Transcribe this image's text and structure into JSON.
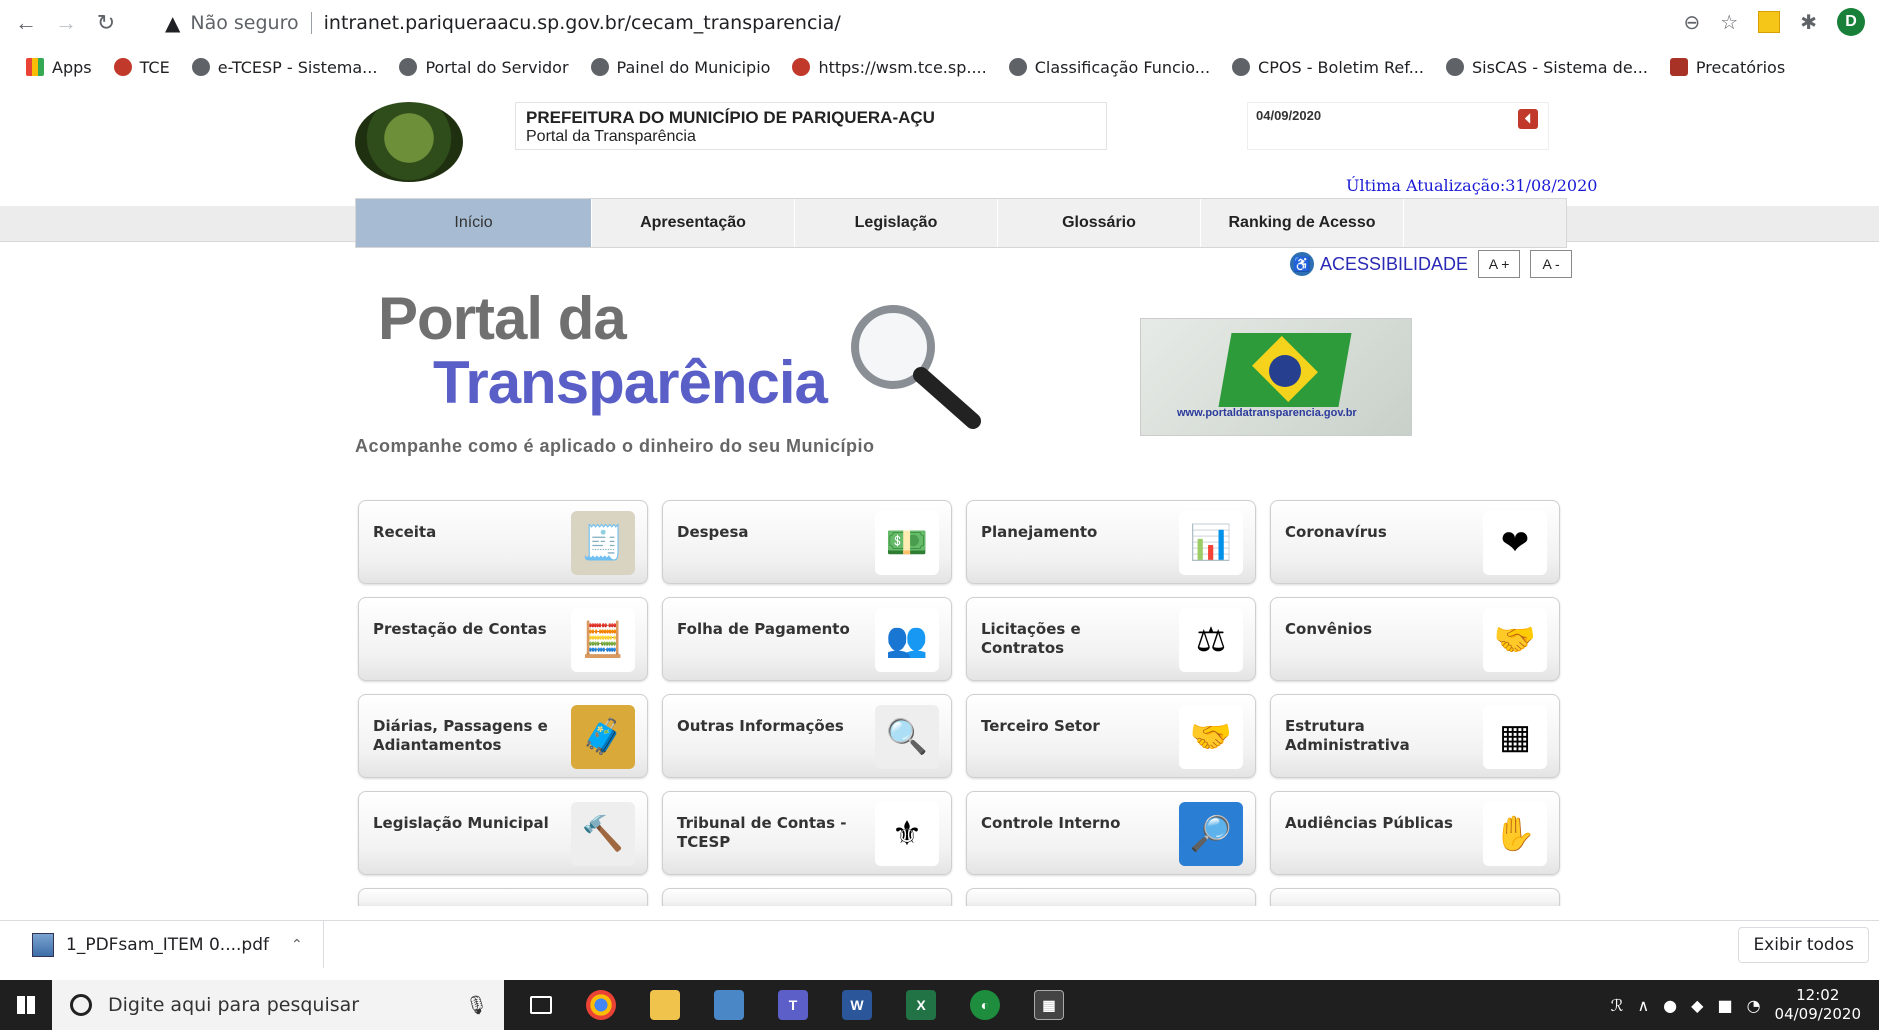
{
  "browser": {
    "back_icon": "arrow-left-icon",
    "forward_icon": "arrow-right-icon",
    "reload_icon": "reload-icon",
    "security_label": "Não seguro",
    "url": "intranet.pariqueraacu.sp.gov.br/cecam_transparencia/",
    "profile_initial": "D"
  },
  "bookmarks": [
    {
      "label": "Apps",
      "icon": "apps-grid-icon"
    },
    {
      "label": "TCE",
      "icon": "tce-icon"
    },
    {
      "label": "e-TCESP - Sistema...",
      "icon": "globe-icon"
    },
    {
      "label": "Portal do Servidor",
      "icon": "portal-servidor-icon"
    },
    {
      "label": "Painel do Municipio",
      "icon": "globe-icon"
    },
    {
      "label": "https://wsm.tce.sp....",
      "icon": "tce-icon"
    },
    {
      "label": "Classificação Funcio...",
      "icon": "globe-icon"
    },
    {
      "label": "CPOS - Boletim Ref...",
      "icon": "globe-icon"
    },
    {
      "label": "SisCAS - Sistema de...",
      "icon": "globe-icon"
    },
    {
      "label": "Precatórios",
      "icon": "sp-icon"
    }
  ],
  "header": {
    "prefeitura": "PREFEITURA DO MUNICÍPIO DE PARIQUERA-AÇU",
    "subtitle": "Portal da Transparência",
    "date": "04/09/2020",
    "last_update": "Última Atualização:31/08/2020"
  },
  "menu": [
    {
      "label": "Início",
      "active": true
    },
    {
      "label": "Apresentação",
      "active": false
    },
    {
      "label": "Legislação",
      "active": false
    },
    {
      "label": "Glossário",
      "active": false
    },
    {
      "label": "Ranking de Acesso",
      "active": false
    }
  ],
  "accessibility": {
    "label": "ACESSIBILIDADE",
    "increase": "A +",
    "decrease": "A -"
  },
  "hero": {
    "title_line1": "Portal da",
    "title_line2": "Transparência",
    "tagline": "Acompanhe como é aplicado o dinheiro do seu Município",
    "banner_url": "www.portaldatransparencia.gov.br"
  },
  "tiles": [
    {
      "label": "Receita",
      "icon": "receipt-icon",
      "color": "#d9d3c2",
      "glyph": "🧾"
    },
    {
      "label": "Despesa",
      "icon": "money-icon",
      "color": "#ffffff",
      "glyph": "💵"
    },
    {
      "label": "Planejamento",
      "icon": "chart-icon",
      "color": "#ffffff",
      "glyph": "📊"
    },
    {
      "label": "Coronavírus",
      "icon": "heart-hands-icon",
      "color": "#ffffff",
      "glyph": "❤"
    },
    {
      "label": "Prestação de Contas",
      "icon": "calculator-icon",
      "color": "#ffffff",
      "glyph": "🧮"
    },
    {
      "label": "Folha de Pagamento",
      "icon": "people-icon",
      "color": "#ffffff",
      "glyph": "👥"
    },
    {
      "label": "Licitações e Contratos",
      "icon": "gavel-icon",
      "color": "#ffffff",
      "glyph": "⚖"
    },
    {
      "label": "Convênios",
      "icon": "handshake-icon",
      "color": "#ffffff",
      "glyph": "🤝"
    },
    {
      "label": "Diárias, Passagens e Adiantamentos",
      "icon": "suitcase-icon",
      "color": "#d9a93a",
      "glyph": "🧳"
    },
    {
      "label": "Outras Informações",
      "icon": "search-icon",
      "color": "#eeeeee",
      "glyph": "🔍"
    },
    {
      "label": "Terceiro Setor",
      "icon": "handshake-icon",
      "color": "#ffffff",
      "glyph": "🤝"
    },
    {
      "label": "Estrutura Administrativa",
      "icon": "org-chart-icon",
      "color": "#ffffff",
      "glyph": "▦"
    },
    {
      "label": "Legislação Municipal",
      "icon": "gavel-icon",
      "color": "#eeeeee",
      "glyph": "🔨"
    },
    {
      "label": "Tribunal de Contas - TCESP",
      "icon": "tce-seal-icon",
      "color": "#ffffff",
      "glyph": "⚜"
    },
    {
      "label": "Controle Interno",
      "icon": "inspection-icon",
      "color": "#2a7fd4",
      "glyph": "🔎"
    },
    {
      "label": "Audiências Públicas",
      "icon": "hands-raised-icon",
      "color": "#ffffff",
      "glyph": "✋"
    }
  ],
  "downloads": {
    "file": "1_PDFsam_ITEM 0....pdf",
    "show_all": "Exibir todos"
  },
  "taskbar": {
    "search_placeholder": "Digite aqui para pesquisar",
    "time": "12:02",
    "date": "04/09/2020"
  }
}
